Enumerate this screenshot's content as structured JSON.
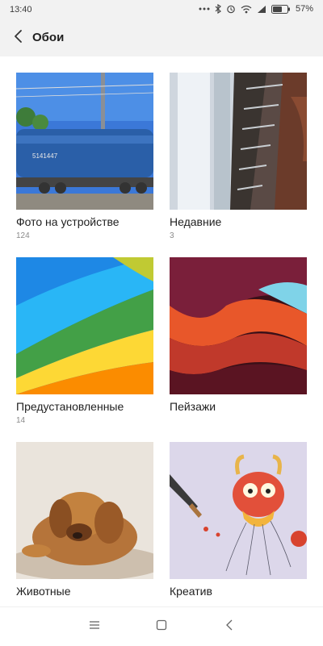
{
  "status_bar": {
    "time": "13:40",
    "battery": "57%",
    "icons": [
      "dots-icon",
      "bluetooth-icon",
      "alarm-icon",
      "wifi-icon",
      "signal-icon",
      "battery-icon"
    ]
  },
  "header": {
    "title": "Обои",
    "back_icon": "chevron-left-icon"
  },
  "categories": [
    {
      "label": "Фото на устройстве",
      "count": "124"
    },
    {
      "label": "Недавние",
      "count": "3"
    },
    {
      "label": "Предустановленные",
      "count": "14"
    },
    {
      "label": "Пейзажи",
      "count": ""
    },
    {
      "label": "Животные",
      "count": ""
    },
    {
      "label": "Креатив",
      "count": ""
    }
  ],
  "nav_bar": {
    "icons": [
      "menu-icon",
      "home-icon",
      "back-icon"
    ]
  },
  "colors": {
    "bar_background": "#f2f2f2",
    "text_primary": "#1f1f1f",
    "text_secondary": "#8a8a8a"
  }
}
